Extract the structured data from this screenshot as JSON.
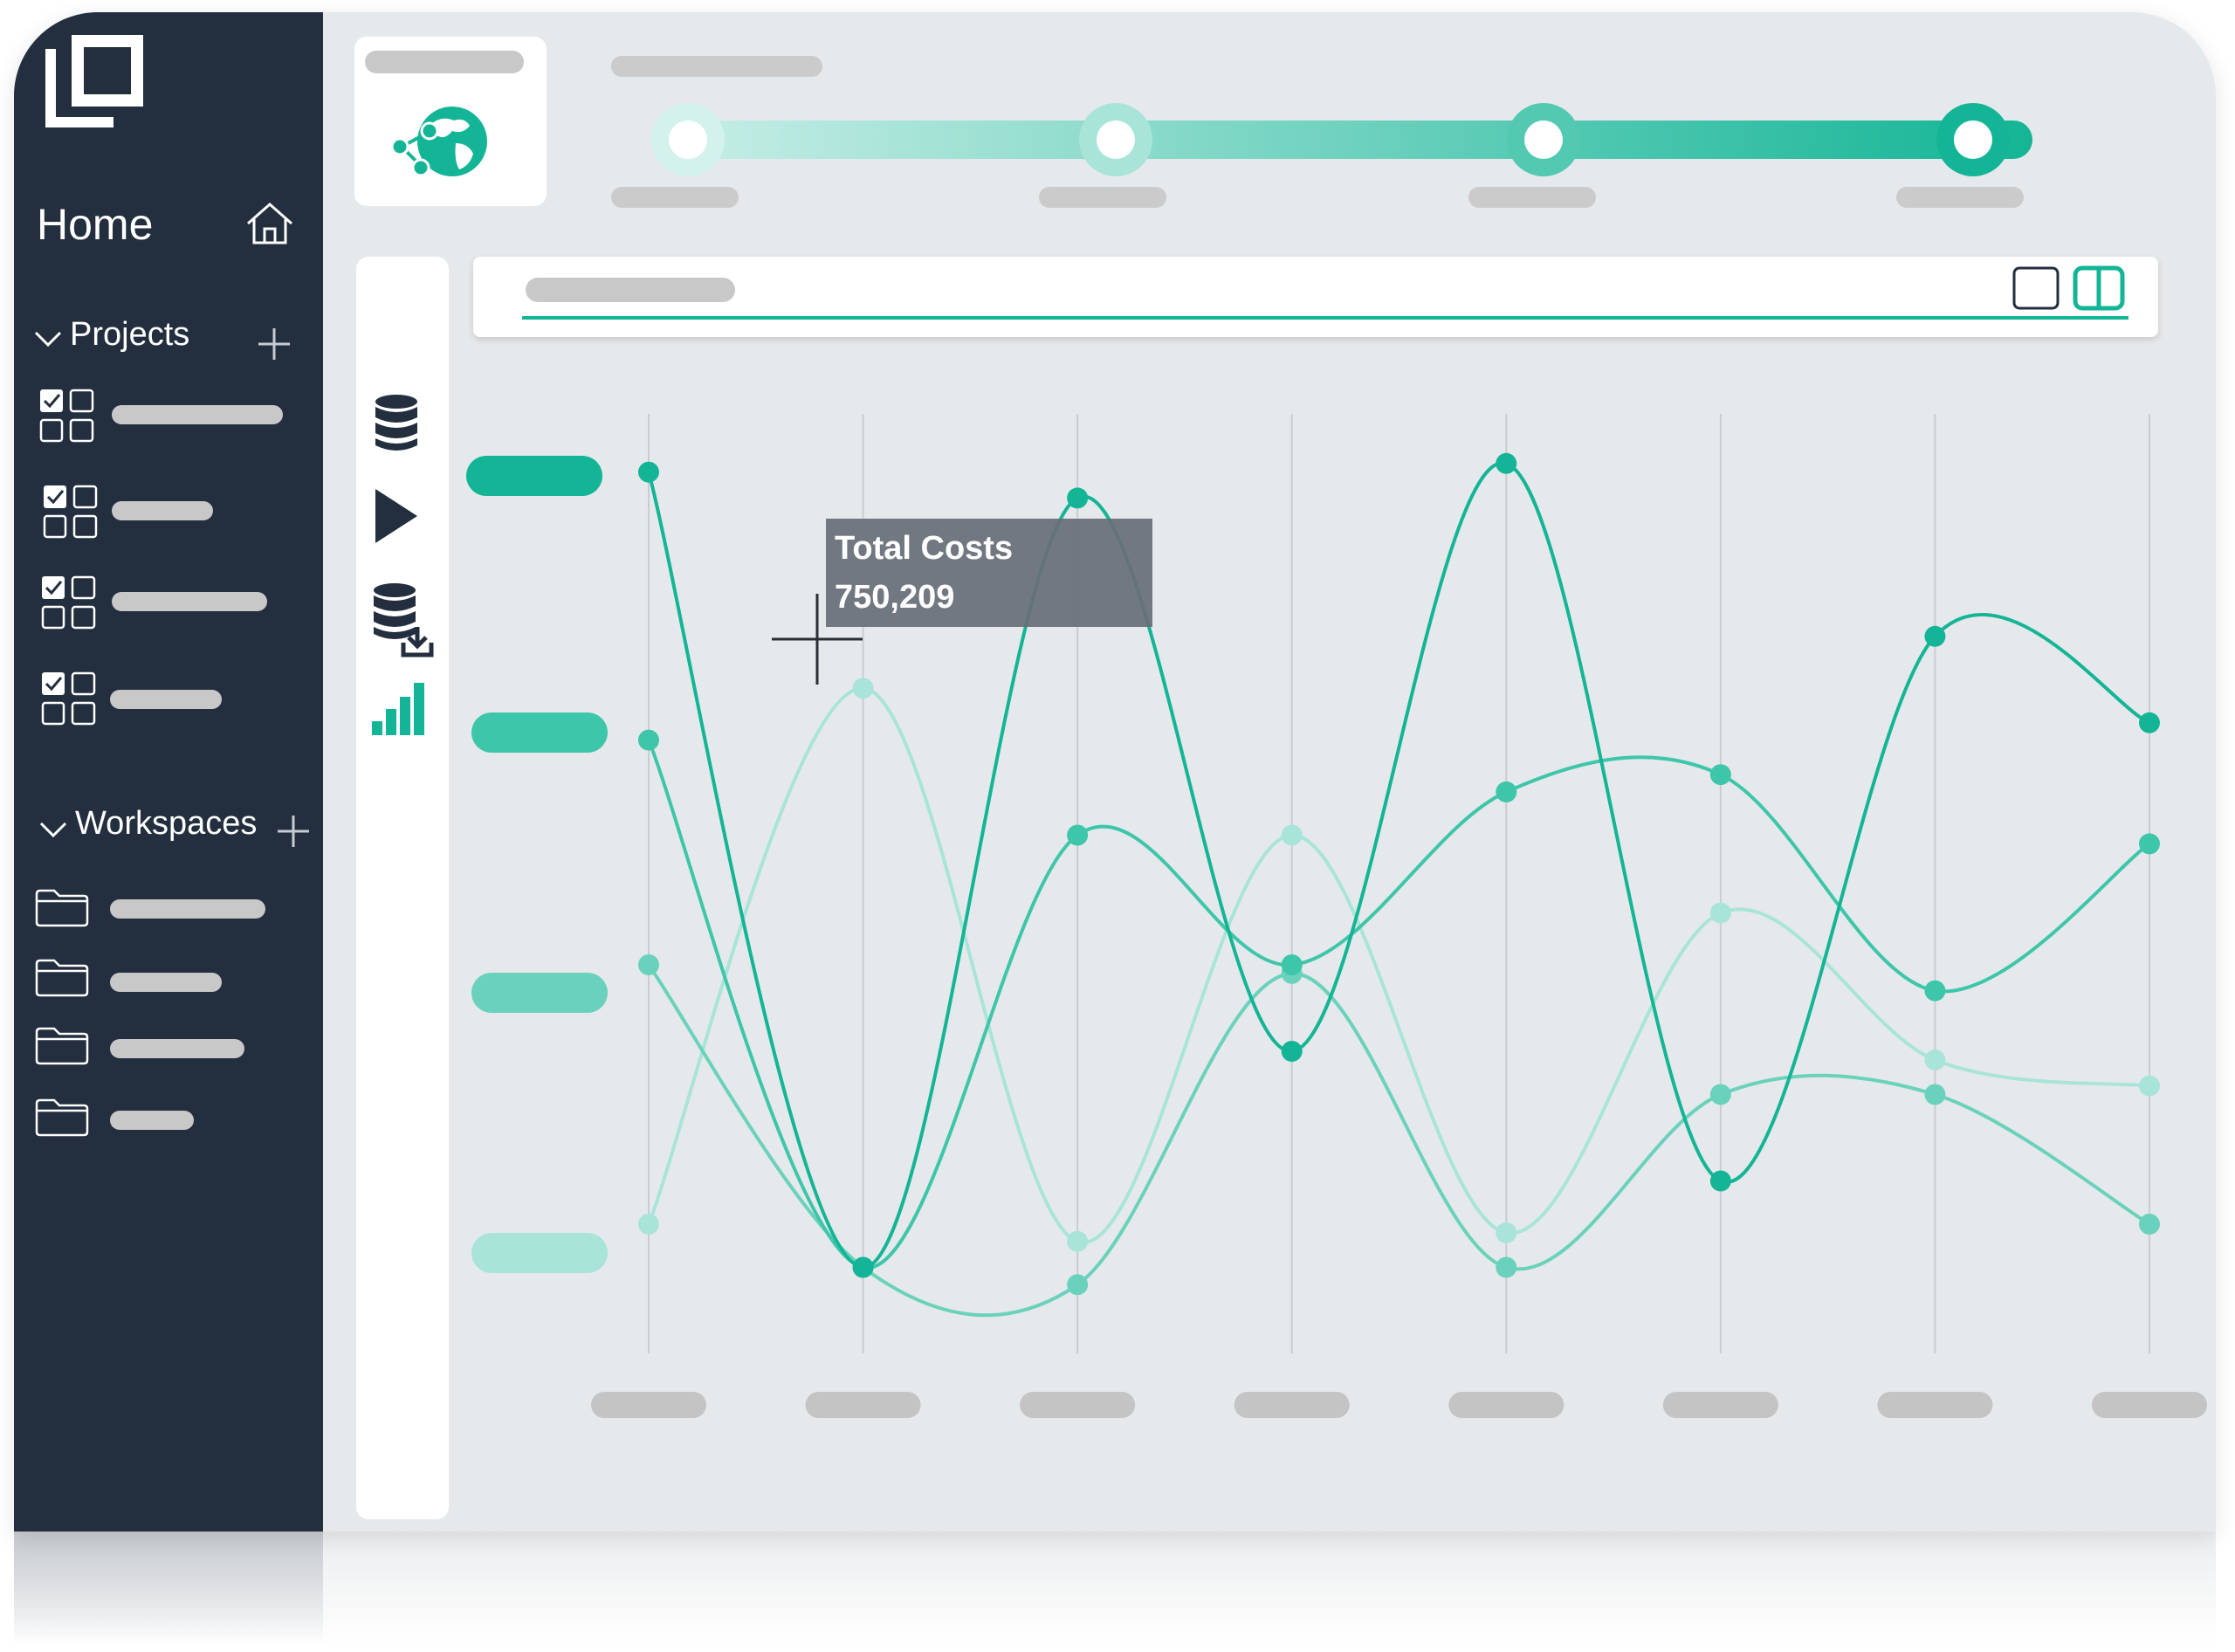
{
  "sidebar": {
    "home_label": "Home",
    "projects_label": "Projects",
    "workspaces_label": "Workspaces",
    "project_items": [
      1,
      2,
      3,
      4
    ],
    "workspace_items": [
      1,
      2,
      3,
      4
    ]
  },
  "progress": {
    "steps": 4,
    "current_step": 4
  },
  "tooltip": {
    "title": "Total Costs",
    "value": "750,209"
  },
  "colors": {
    "sidebar": "#232e3e",
    "background": "#e6e9eb",
    "accent": "#14b596",
    "series": [
      "#14b596",
      "#3ec6aa",
      "#6ad2bc",
      "#a8e5d8"
    ]
  },
  "icons": {
    "logo": "logo-mark",
    "home": "home-icon",
    "tools": [
      "database-icon",
      "play-icon",
      "database-download-icon",
      "bar-chart-icon"
    ],
    "view": [
      "single-view-icon",
      "split-view-icon"
    ]
  },
  "chart_data": {
    "type": "line",
    "smooth": true,
    "x": [
      1,
      2,
      3,
      4,
      5,
      6,
      7,
      8
    ],
    "ylim": [
      0,
      100
    ],
    "grid": "vertical",
    "series": [
      {
        "values": [
          97,
          5,
          94,
          30,
          98,
          15,
          78,
          68
        ]
      },
      {
        "values": [
          66,
          5,
          55,
          40,
          60,
          62,
          37,
          54
        ]
      },
      {
        "values": [
          40,
          5,
          3,
          39,
          5,
          25,
          25,
          10
        ]
      },
      {
        "values": [
          10,
          72,
          8,
          55,
          9,
          46,
          29,
          26
        ]
      }
    ]
  }
}
